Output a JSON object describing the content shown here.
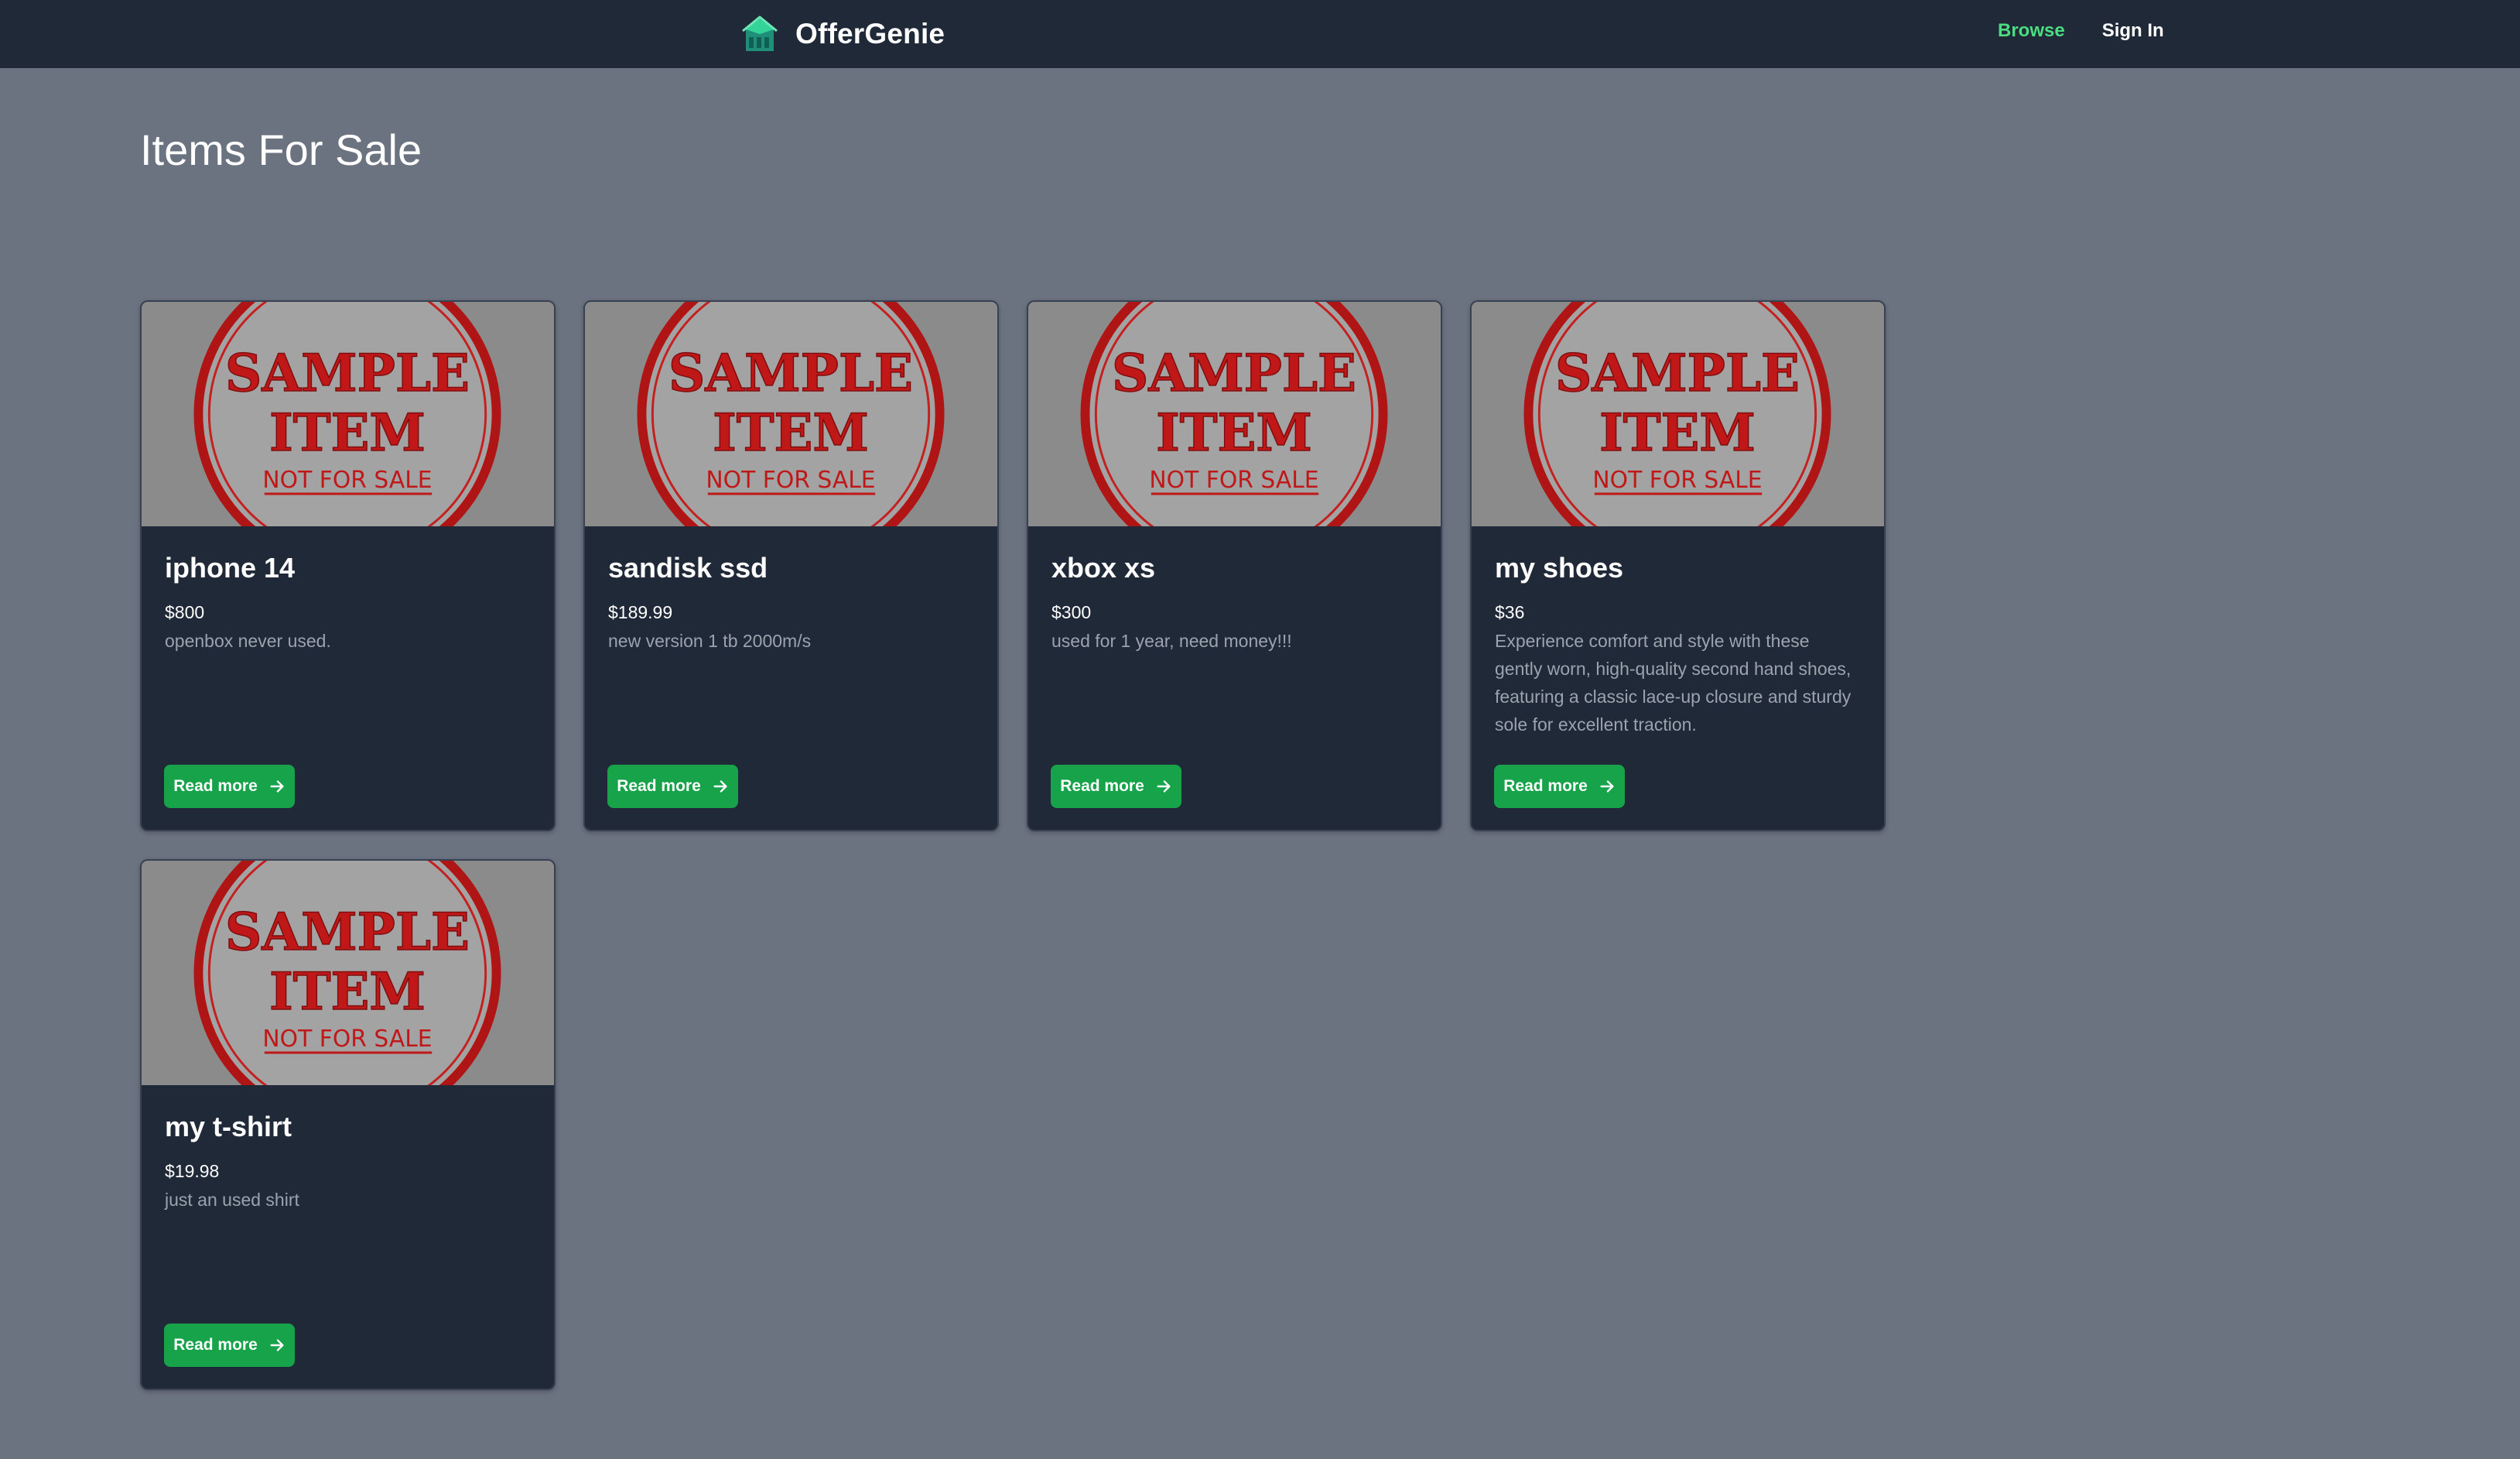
{
  "header": {
    "brand_name": "OfferGenie",
    "logo_icon": "store-icon",
    "nav": {
      "browse": "Browse",
      "sign_in": "Sign In"
    },
    "colors": {
      "background": "#1f2937",
      "active_link": "#4ade80"
    }
  },
  "main": {
    "title": "Items For Sale",
    "sample_image": {
      "line1": "SAMPLE",
      "line2": "ITEM",
      "line3": "NOT FOR SALE"
    },
    "items": [
      {
        "title": "iphone 14",
        "price": "$800",
        "description": "openbox never used.",
        "button_label": "Read more"
      },
      {
        "title": "sandisk ssd",
        "price": "$189.99",
        "description": "new version 1 tb 2000m/s",
        "button_label": "Read more"
      },
      {
        "title": "xbox xs",
        "price": "$300",
        "description": "used for 1 year, need money!!!",
        "button_label": "Read more"
      },
      {
        "title": "my shoes",
        "price": "$36",
        "description": "Experience comfort and style with these gently worn, high-quality second hand shoes, featuring a classic lace-up closure and sturdy sole for excellent traction.",
        "button_label": "Read more"
      },
      {
        "title": "my t-shirt",
        "price": "$19.98",
        "description": "just an used shirt",
        "button_label": "Read more"
      }
    ],
    "colors": {
      "page_background": "#6b7280",
      "card_background": "#1f2937",
      "button": "#16a34a",
      "stamp_red": "#c01818"
    }
  }
}
